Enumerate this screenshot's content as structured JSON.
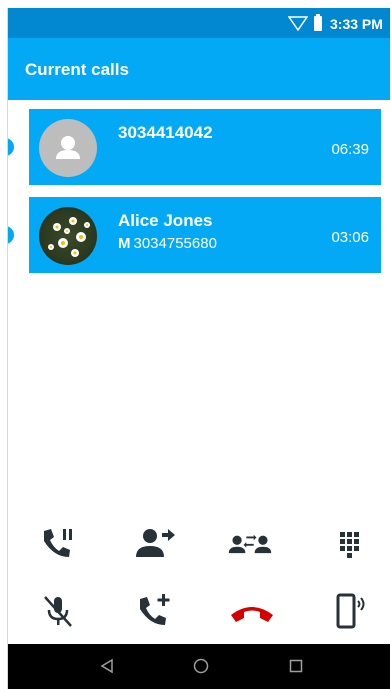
{
  "status_bar": {
    "time": "3:33 PM",
    "icons": [
      "wifi-signal-icon",
      "battery-icon"
    ]
  },
  "app_bar": {
    "title": "Current calls"
  },
  "calls": [
    {
      "name": "3034414042",
      "number_type": "",
      "number": "",
      "duration": "06:39",
      "avatar": "default-person-avatar"
    },
    {
      "name": "Alice Jones",
      "number_type": "M",
      "number": "3034755680",
      "duration": "03:06",
      "avatar": "photo-avatar"
    }
  ],
  "controls": {
    "row1": [
      "hold-call-icon",
      "transfer-call-icon",
      "swap-calls-icon",
      "dialpad-icon"
    ],
    "row2": [
      "mute-microphone-icon",
      "add-call-icon",
      "end-call-icon",
      "speaker-phone-icon"
    ]
  },
  "nav_bar": {
    "buttons": [
      "back-icon",
      "home-icon",
      "recents-icon"
    ]
  },
  "colors": {
    "status_bar": "#0288d1",
    "primary": "#03a9f4",
    "icon_dark": "#263238",
    "end_call": "#d50000",
    "nav_bar": "#000000"
  }
}
